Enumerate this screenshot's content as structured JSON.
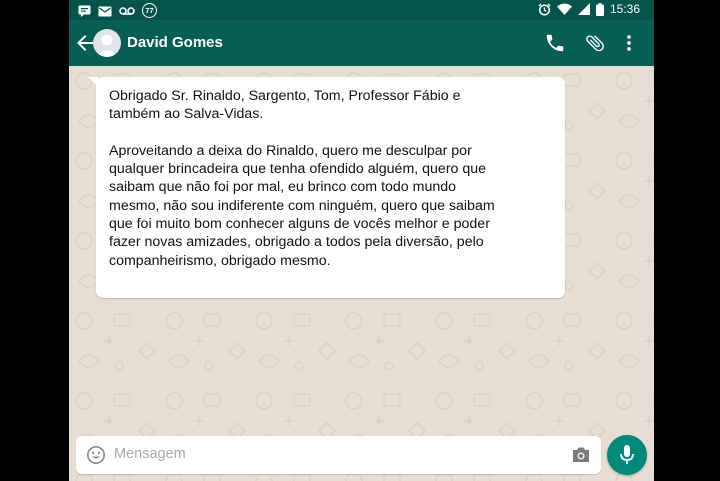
{
  "status_bar": {
    "time": "15:36",
    "notification_badge": "77",
    "icons": [
      "message-icon",
      "inbox-icon",
      "voicemail-icon",
      "badge-77-icon",
      "alarm-icon",
      "wifi-icon",
      "signal-icon",
      "battery-icon"
    ]
  },
  "header": {
    "contact_name": "David Gomes",
    "icons": [
      "back-arrow-icon",
      "avatar",
      "phone-icon",
      "attach-icon",
      "more-vert-icon"
    ]
  },
  "chat": {
    "message": "Obrigado Sr. Rinaldo, Sargento, Tom, Professor Fábio e\ntambém ao Salva-Vidas.\n\nAproveitando a deixa do Rinaldo, quero me desculpar por\nqualquer brincadeira que tenha ofendido alguém, quero que\nsaibam que não foi por mal, eu brinco com todo mundo\nmesmo, não sou indiferente com ninguém, quero que saibam\nque foi muito bom conhecer alguns de vocês melhor e poder\nfazer novas amizades, obrigado a todos pela diversão, pelo\ncompanheirismo, obrigado mesmo."
  },
  "composer": {
    "placeholder": "Mensagem",
    "value": "",
    "icons": [
      "emoji-icon",
      "camera-icon",
      "mic-icon"
    ]
  },
  "colors": {
    "status_bar": "#05544c",
    "toolbar": "#075e55",
    "wallpaper": "#e6ddd3",
    "mic_button": "#00897b"
  }
}
